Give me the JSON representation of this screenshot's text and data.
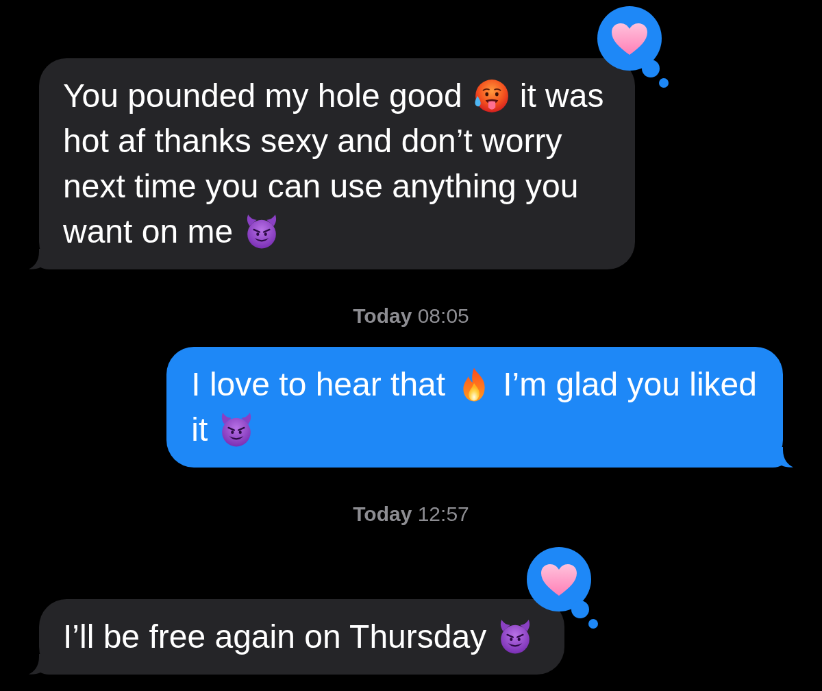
{
  "conversation": {
    "items": [
      {
        "kind": "received",
        "reaction": {
          "kind": "heart"
        },
        "lines": [
          [
            {
              "kind": "text",
              "text": "You pounded my hole good"
            },
            {
              "kind": "hot_face"
            },
            {
              "kind": "text",
              "text": "it was"
            }
          ],
          [
            {
              "kind": "text",
              "text": "hot af thanks sexy and don’t worry"
            }
          ],
          [
            {
              "kind": "text",
              "text": "next time you can use anything you"
            }
          ],
          [
            {
              "kind": "text",
              "text": "want on me"
            },
            {
              "kind": "smiling_devil"
            }
          ]
        ]
      },
      {
        "kind": "timestamp",
        "text": "**Today** 08:05"
      },
      {
        "kind": "sent",
        "lines": [
          [
            {
              "kind": "text",
              "text": "I love to hear that"
            },
            {
              "kind": "fire"
            },
            {
              "kind": "text",
              "text": "I’m glad you liked"
            }
          ],
          [
            {
              "kind": "text",
              "text": "it"
            },
            {
              "kind": "smiling_devil"
            }
          ]
        ]
      },
      {
        "kind": "timestamp",
        "text": "**Today** 12:57"
      },
      {
        "kind": "received",
        "reaction": {
          "kind": "heart"
        },
        "lines": [
          [
            {
              "kind": "text",
              "text": "I’ll be free again on Thursday"
            },
            {
              "kind": "smiling_devil"
            }
          ]
        ]
      }
    ]
  }
}
